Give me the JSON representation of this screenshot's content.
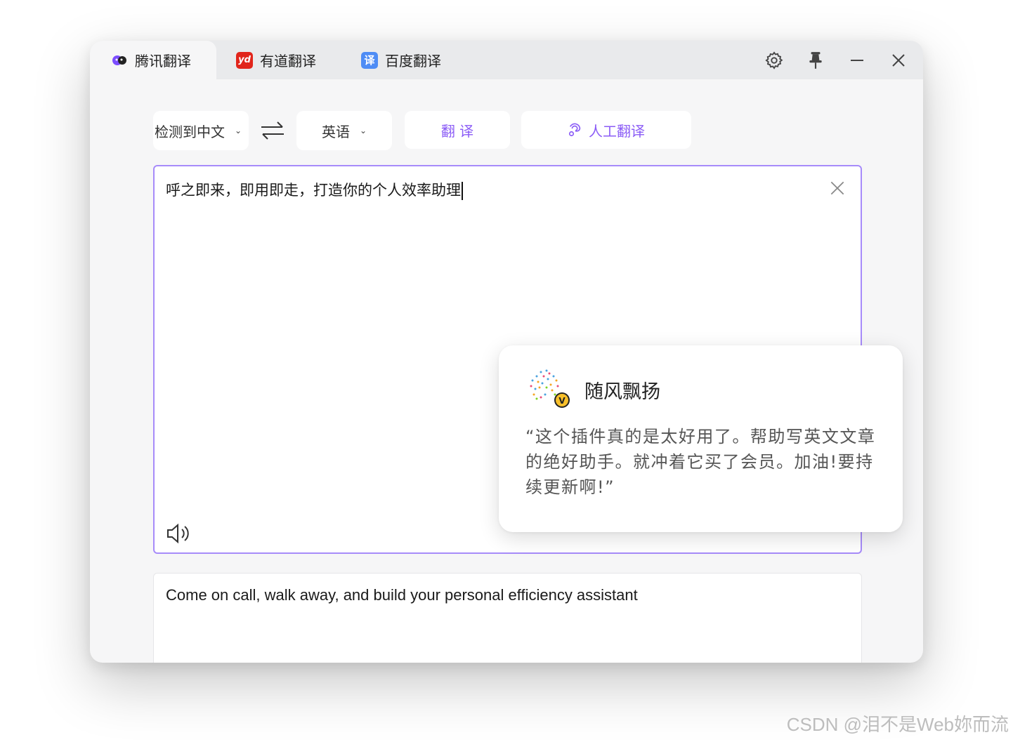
{
  "tabs": [
    {
      "label": "腾讯翻译",
      "icon": "tencent-logo-icon",
      "active": true
    },
    {
      "label": "有道翻译",
      "icon": "youdao-logo-icon",
      "icon_text": "yd"
    },
    {
      "label": "百度翻译",
      "icon": "baidu-logo-icon",
      "icon_text": "译"
    }
  ],
  "window_controls": {
    "settings": "gear-icon",
    "pin": "pin-icon",
    "minimize": "minimize-icon",
    "close": "close-icon"
  },
  "toolbar": {
    "source_lang": "检测到中文",
    "target_lang": "英语",
    "translate_label": "翻 译",
    "human_translate_label": "人工翻译"
  },
  "source": {
    "text": "呼之即来，即用即走，打造你的个人效率助理"
  },
  "result": {
    "text": "Come on call, walk away, and build your personal efficiency assistant"
  },
  "testimonial": {
    "name": "随风飘扬",
    "quote": "“这个插件真的是太好用了。帮助写英文文章的绝好助手。就冲着它买了会员。加油!要持续更新啊!”",
    "badge": "V"
  },
  "watermark": "CSDN @泪不是Web妳而流",
  "colors": {
    "accent": "#8b5cf6",
    "border_active": "#a78bfa",
    "youdao": "#e1251b",
    "baidu": "#4e8cf5"
  }
}
